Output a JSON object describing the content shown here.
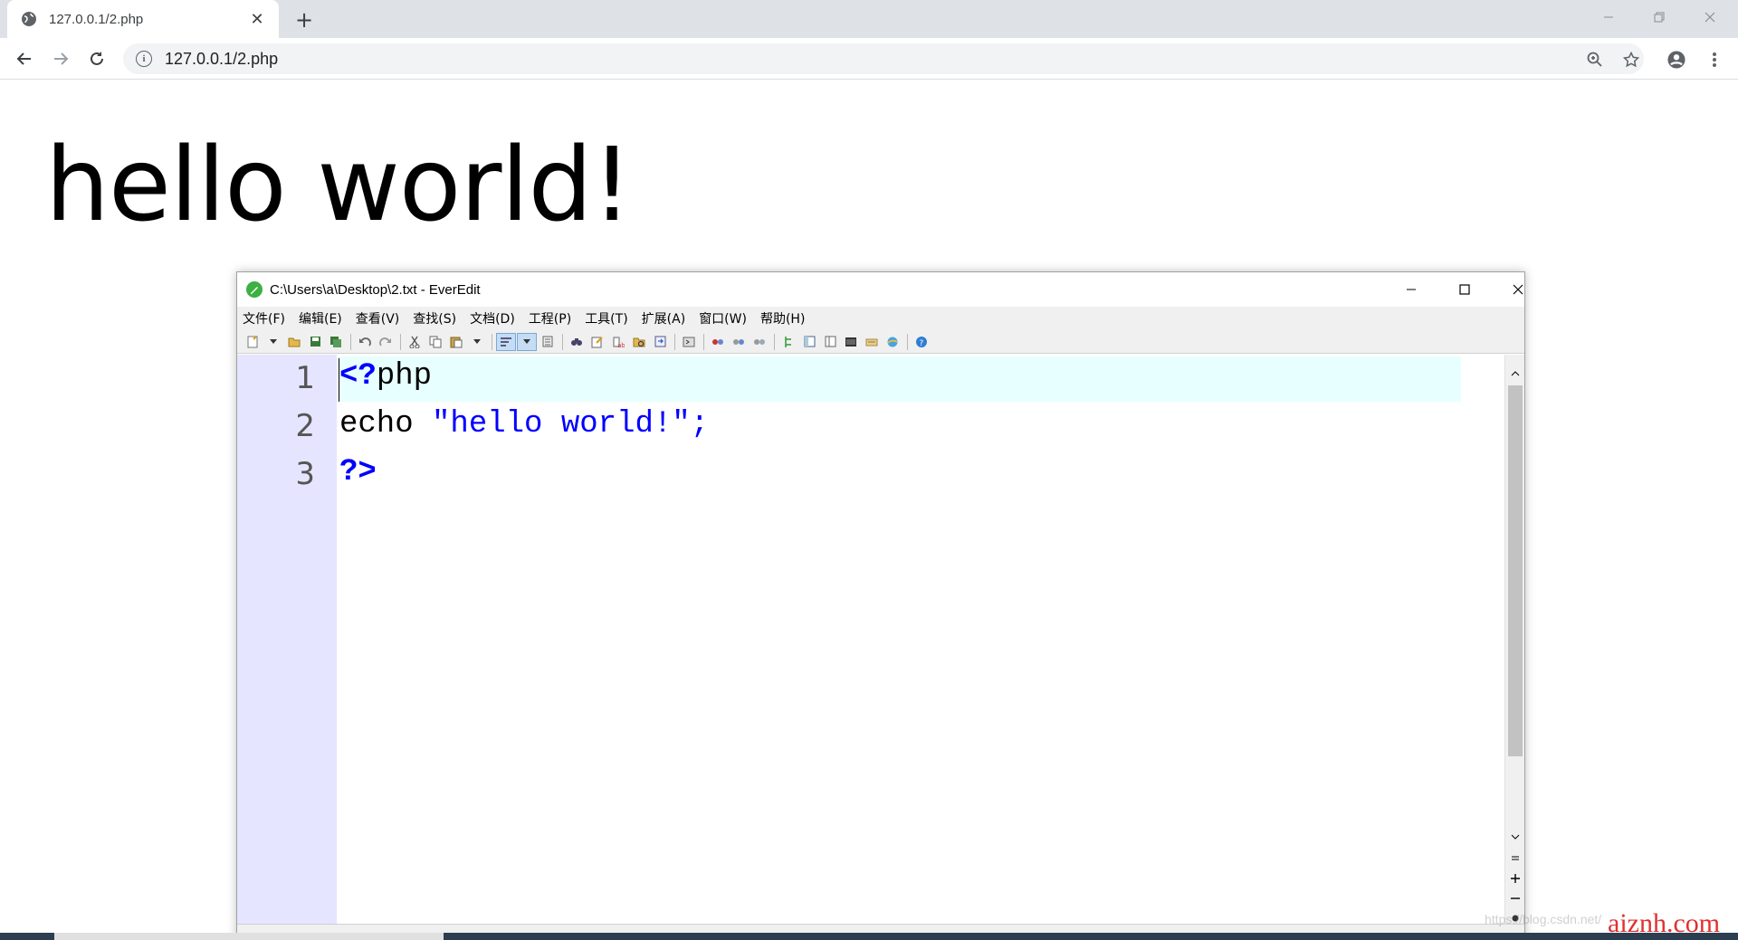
{
  "browser": {
    "tab_title": "127.0.0.1/2.php",
    "tab_close": "✕",
    "new_tab": "+",
    "url": "127.0.0.1/2.php",
    "icons": {
      "favicon": "globe-icon",
      "back": "arrow-left-icon",
      "forward": "arrow-right-icon",
      "reload": "reload-icon",
      "site_info": "info-icon",
      "zoom": "zoom-icon",
      "bookmark": "star-icon",
      "profile": "account-icon",
      "menu": "kebab-menu-icon"
    }
  },
  "page": {
    "heading": "hello world!"
  },
  "editor": {
    "window_title": "C:\\Users\\a\\Desktop\\2.txt - EverEdit",
    "menu": [
      "文件(F)",
      "编辑(E)",
      "查看(V)",
      "查找(S)",
      "文档(D)",
      "工程(P)",
      "工具(T)",
      "扩展(A)",
      "窗口(W)",
      "帮助(H)"
    ],
    "line_numbers": [
      "1",
      "2",
      "3"
    ],
    "code": {
      "line1_tag": "<?",
      "line1_rest": "php",
      "line2_keyword": "echo ",
      "line2_string": "\"hello world!\";",
      "line3": "?>"
    },
    "colors": {
      "gutter": "#e5e5ff",
      "current_line": "#e8ffff",
      "php_tag": "#0000ff"
    }
  },
  "watermark": {
    "text": "https://blog.csdn.net/",
    "brand": "aiznh.com"
  }
}
